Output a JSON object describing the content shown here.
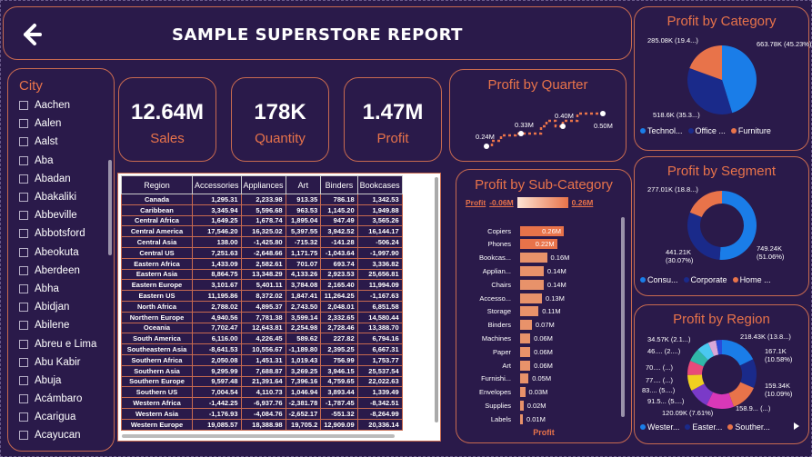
{
  "header": {
    "title": "SAMPLE SUPERSTORE REPORT"
  },
  "city": {
    "title": "City",
    "items": [
      "Aachen",
      "Aalen",
      "Aalst",
      "Aba",
      "Abadan",
      "Abakaliki",
      "Abbeville",
      "Abbotsford",
      "Abeokuta",
      "Aberdeen",
      "Abha",
      "Abidjan",
      "Abilene",
      "Abreu e Lima",
      "Abu Kabir",
      "Abuja",
      "Acámbaro",
      "Acarigua",
      "Acayucan"
    ]
  },
  "kpis": [
    {
      "value": "12.64M",
      "label": "Sales"
    },
    {
      "value": "178K",
      "label": "Quantity"
    },
    {
      "value": "1.47M",
      "label": "Profit"
    }
  ],
  "quarter": {
    "title": "Profit by Quarter",
    "labels": [
      "0.24M",
      "0.33M",
      "0.40M",
      "0.50M"
    ],
    "values": [
      0.24,
      0.33,
      0.4,
      0.5
    ]
  },
  "table": {
    "headers": [
      "Region",
      "Accessories",
      "Appliances",
      "Art",
      "Binders",
      "Bookcases"
    ],
    "rows": [
      [
        "Canada",
        "1,295.31",
        "2,233.98",
        "913.35",
        "786.18",
        "1,342.53"
      ],
      [
        "Caribbean",
        "3,345.94",
        "5,596.68",
        "963.53",
        "1,145.20",
        "1,949.88"
      ],
      [
        "Central Africa",
        "1,649.25",
        "1,678.74",
        "1,895.04",
        "947.49",
        "3,565.26"
      ],
      [
        "Central America",
        "17,546.20",
        "16,325.02",
        "5,397.55",
        "3,942.52",
        "16,144.17"
      ],
      [
        "Central Asia",
        "138.00",
        "-1,425.80",
        "-715.32",
        "-141.28",
        "-506.24"
      ],
      [
        "Central US",
        "7,251.63",
        "-2,648.66",
        "1,171.75",
        "-1,043.64",
        "-1,997.90"
      ],
      [
        "Eastern Africa",
        "1,433.09",
        "2,582.61",
        "701.07",
        "693.74",
        "3,336.82"
      ],
      [
        "Eastern Asia",
        "8,864.75",
        "13,348.29",
        "4,133.26",
        "2,923.53",
        "25,656.81"
      ],
      [
        "Eastern Europe",
        "3,101.67",
        "5,401.11",
        "3,784.08",
        "2,165.40",
        "11,994.09"
      ],
      [
        "Eastern US",
        "11,195.86",
        "8,372.02",
        "1,847.41",
        "11,264.25",
        "-1,167.63"
      ],
      [
        "North Africa",
        "2,788.02",
        "4,895.37",
        "2,743.50",
        "2,048.01",
        "6,851.58"
      ],
      [
        "Northern Europe",
        "4,940.56",
        "7,781.38",
        "3,599.14",
        "2,332.65",
        "14,580.44"
      ],
      [
        "Oceania",
        "7,702.47",
        "12,643.81",
        "2,254.98",
        "2,728.46",
        "13,388.70"
      ],
      [
        "South America",
        "6,116.00",
        "4,226.45",
        "589.62",
        "227.82",
        "6,794.16"
      ],
      [
        "Southeastern Asia",
        "-8,641.53",
        "10,556.67",
        "-1,189.80",
        "2,395.25",
        "6,667.31"
      ],
      [
        "Southern Africa",
        "2,050.08",
        "1,451.31",
        "1,019.43",
        "756.99",
        "1,753.77"
      ],
      [
        "Southern Asia",
        "9,295.99",
        "7,688.87",
        "3,269.25",
        "3,946.15",
        "25,537.54"
      ],
      [
        "Southern Europe",
        "9,597.48",
        "21,391.64",
        "7,396.16",
        "4,759.65",
        "22,022.63"
      ],
      [
        "Southern US",
        "7,004.54",
        "4,110.73",
        "1,046.94",
        "3,893.44",
        "1,339.49"
      ],
      [
        "Western Africa",
        "-1,442.25",
        "-6,937.76",
        "-2,381.78",
        "-1,787.45",
        "-8,342.51"
      ],
      [
        "Western Asia",
        "-1,176.93",
        "-4,084.76",
        "-2,652.17",
        "-551.32",
        "-8,264.99"
      ],
      [
        "Western Europe",
        "19,085.57",
        "18,388.98",
        "19,705.2",
        "12,909.09",
        "20,336.14"
      ]
    ]
  },
  "subcategory": {
    "title": "Profit by Sub-Category",
    "legend_label": "Profit",
    "legend_min": "-0.06M",
    "legend_max": "0.26M",
    "axis_label": "Profit",
    "chart_data": {
      "type": "bar",
      "categories": [
        "Copiers",
        "Phones",
        "Bookcas...",
        "Applian...",
        "Chairs",
        "Accesso...",
        "Storage",
        "Binders",
        "Machines",
        "Paper",
        "Art",
        "Furnishi...",
        "Envelopes",
        "Supplies",
        "Labels"
      ],
      "values": [
        0.26,
        0.22,
        0.16,
        0.14,
        0.14,
        0.13,
        0.11,
        0.07,
        0.06,
        0.06,
        0.06,
        0.05,
        0.03,
        0.02,
        0.01
      ],
      "labels": [
        "0.26M",
        "0.22M",
        "0.16M",
        "0.14M",
        "0.14M",
        "0.13M",
        "0.11M",
        "0.07M",
        "0.06M",
        "0.06M",
        "0.06M",
        "0.05M",
        "0.03M",
        "0.02M",
        "0.01M"
      ]
    }
  },
  "category": {
    "title": "Profit by Category",
    "labels": [
      "663.78K (45.23%)",
      "518.6K (35.3...)",
      "285.08K (19.4...)"
    ],
    "legend": [
      "Technol...",
      "Office ...",
      "Furniture"
    ],
    "colors": [
      "#1a7de8",
      "#1a2a8a",
      "#e8734a"
    ],
    "values": [
      663.78,
      518.6,
      285.08
    ]
  },
  "segment": {
    "title": "Profit by Segment",
    "labels": [
      "749.24K (51.06%)",
      "441.21K (30.07%)",
      "277.01K (18.8...)"
    ],
    "legend": [
      "Consu...",
      "Corporate",
      "Home ..."
    ],
    "colors": [
      "#1a7de8",
      "#1a2a8a",
      "#e8734a"
    ],
    "values": [
      749.24,
      441.21,
      277.01
    ]
  },
  "region": {
    "title": "Profit by Region",
    "labels": [
      "218.43K (13.8...)",
      "167.1K (10.58%)",
      "159.34K (10.09%)",
      "158.9... (...)",
      "120.09K (7.61%)",
      "91.5... (5....)",
      "83.... (5....)",
      "77.... (...)",
      "70.... (...)",
      "46.... (2....)",
      "34.57K (2.1...)"
    ],
    "legend": [
      "Wester...",
      "Easter...",
      "Souther..."
    ],
    "colors": [
      "#1a7de8",
      "#1a2a8a",
      "#e8734a",
      "#d838b8",
      "#7a3ac8",
      "#f0d020",
      "#e84a7a",
      "#30b8a8",
      "#4ac8f0",
      "#d8a8d8",
      "#2a4ad8"
    ],
    "values": [
      218.43,
      167.1,
      159.34,
      158.9,
      120.09,
      91.5,
      83,
      77,
      70,
      46,
      34.57
    ]
  }
}
